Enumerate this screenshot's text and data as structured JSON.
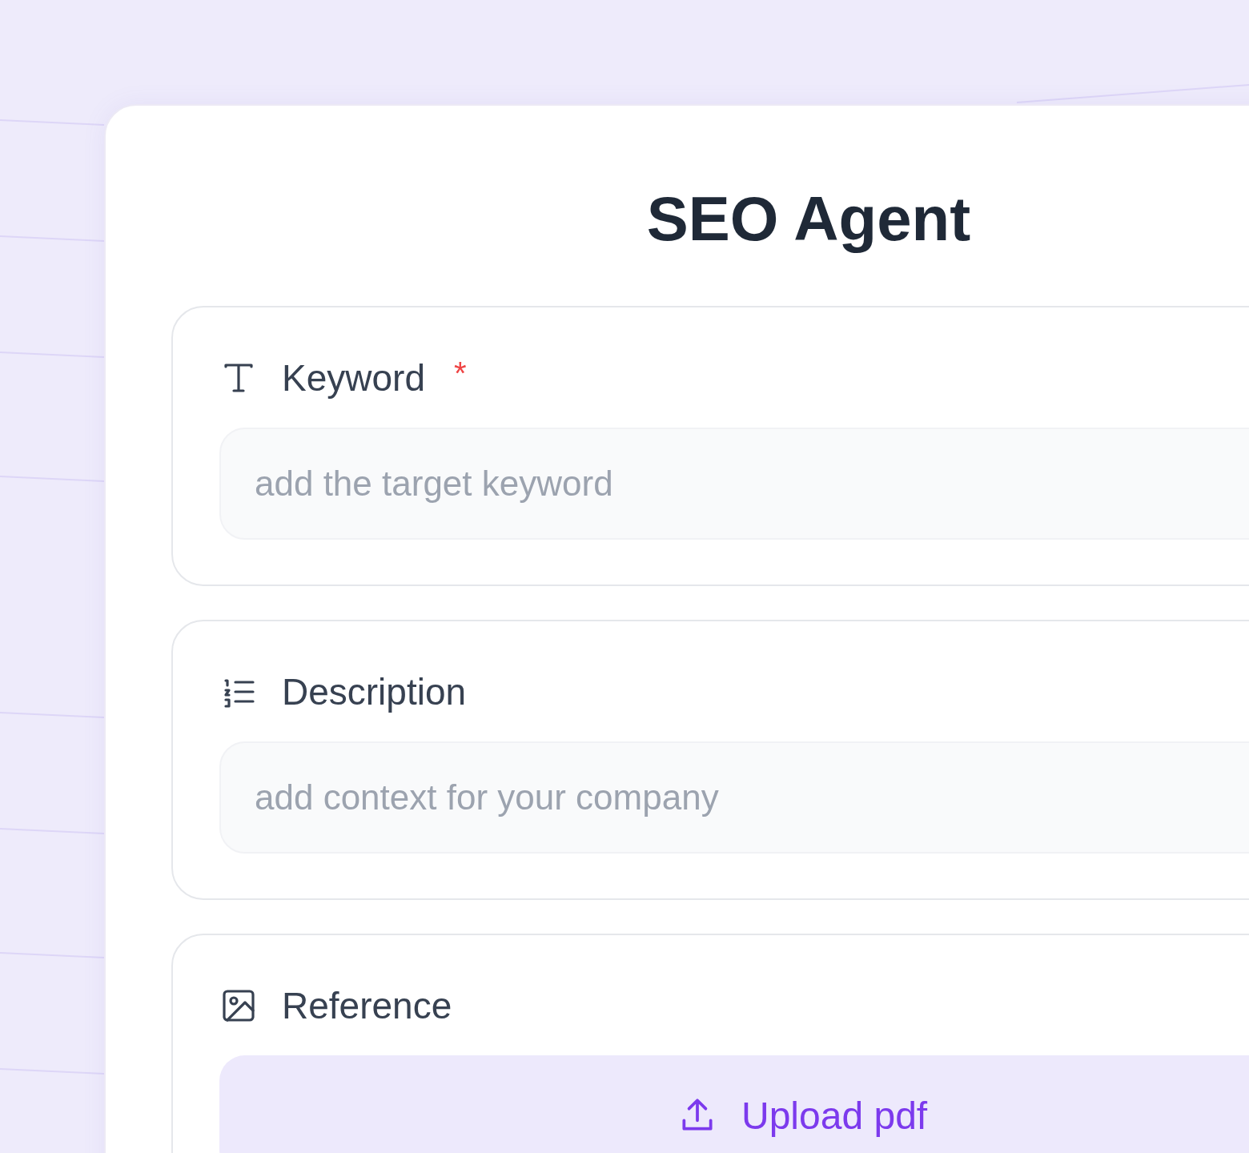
{
  "title": "SEO Agent",
  "fields": [
    {
      "kind": "text",
      "label": "Keyword",
      "required_mark": "*",
      "placeholder": "add the target keyword"
    },
    {
      "kind": "text",
      "label": "Description",
      "placeholder": "add context for your company"
    },
    {
      "kind": "upload",
      "label": "Reference",
      "button": "Upload pdf"
    }
  ]
}
